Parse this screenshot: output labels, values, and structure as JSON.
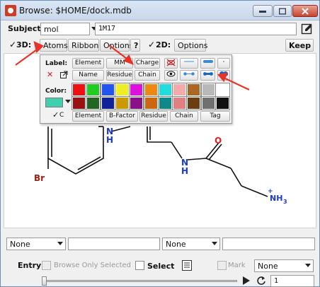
{
  "window": {
    "title": "Browse: $HOME/dock.mdb"
  },
  "subject": {
    "label": "Subject:",
    "selected": "mol",
    "value": "1M17"
  },
  "toolbar": {
    "three_d_label": "3D:",
    "atoms": "Atoms",
    "ribbon": "Ribbon",
    "options": "Options",
    "help": "?",
    "two_d_label": "2D:",
    "options2": "Options",
    "keep": "Keep"
  },
  "palette": {
    "label_heading": "Label:",
    "element": "Element",
    "mm": "MM",
    "charge": "Charge",
    "name": "Name",
    "residue": "Residue",
    "chain": "Chain",
    "color_heading": "Color:",
    "c_check": "C",
    "color_buttons": [
      "Element",
      "B-Factor",
      "Residue",
      "Chain",
      "Tag"
    ],
    "swatches_top": [
      "#ee1111",
      "#22cc22",
      "#2255ee",
      "#eeee22",
      "#dd11dd",
      "#ee8811",
      "#22dddd",
      "#f2aaaa",
      "#aa6622",
      "#b8b8b8",
      "#ffffff"
    ],
    "swatches_bottom": [
      "#991111",
      "#226622",
      "#112299",
      "#cc9900",
      "#881188",
      "#cc6611",
      "#118888",
      "#e08080",
      "#6b3e11",
      "#707070",
      "#111111"
    ],
    "selected_color": "#40d0b0"
  },
  "molecule": {
    "n1": "N",
    "h1": "H",
    "n2": "N",
    "h2": "H",
    "o": "O",
    "br": "Br",
    "nh3": "NH",
    "nh3_sub": "3",
    "plus": "+"
  },
  "filters": {
    "left_select": "None",
    "right_select": "None"
  },
  "entry": {
    "label": "Entry:",
    "browse_only_selected": "Browse Only Selected",
    "select": "Select",
    "mark": "Mark",
    "mark_select": "None",
    "page": "1"
  },
  "colors": {
    "arrow": "#e8332a",
    "nitrogen": "#1a3ad0",
    "oxygen": "#e02020",
    "bromine": "#a02010"
  }
}
